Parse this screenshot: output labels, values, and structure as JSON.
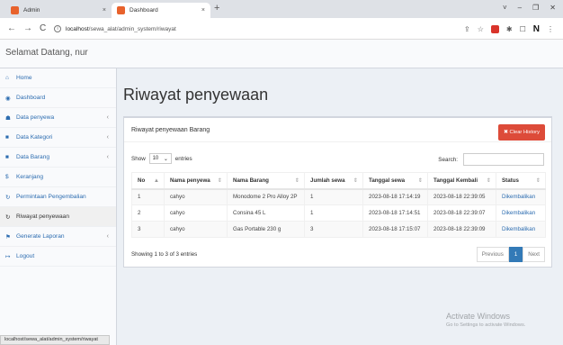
{
  "browser": {
    "tabs": [
      {
        "title": "Admin",
        "close": "×"
      },
      {
        "title": "Dashboard",
        "close": "×"
      }
    ],
    "new_tab": "+",
    "window_controls": [
      "˅",
      "–",
      "❐",
      "✕"
    ],
    "url_host": "localhost",
    "url_path": "/sewa_alat/admin_system/riwayat",
    "status_url": "localhost/sewa_alat/admin_system/riwayat"
  },
  "header": {
    "welcome": "Selamat Datang, nur"
  },
  "sidebar": {
    "items": [
      {
        "icon": "⌂",
        "label": "Home",
        "chevron": ""
      },
      {
        "icon": "◉",
        "label": "Dashboard",
        "chevron": ""
      },
      {
        "icon": "☗",
        "label": "Data penyewa",
        "chevron": "‹"
      },
      {
        "icon": "■",
        "label": "Data Kategori",
        "chevron": "‹"
      },
      {
        "icon": "■",
        "label": "Data Barang",
        "chevron": "‹"
      },
      {
        "icon": "$",
        "label": "Keranjang",
        "chevron": ""
      },
      {
        "icon": "↻",
        "label": "Permintaan Pengembalian",
        "chevron": ""
      },
      {
        "icon": "↻",
        "label": "Riwayat penyewaan",
        "chevron": ""
      },
      {
        "icon": "⚑",
        "label": "Generate Laporan",
        "chevron": "‹"
      },
      {
        "icon": "↦",
        "label": "Logout",
        "chevron": ""
      }
    ]
  },
  "main": {
    "title": "Riwayat penyewaan",
    "box_title": "Riwayat penyewaan Barang",
    "clear_button": "✖ Clear History",
    "show_label": "Show",
    "entries_value": "10",
    "entries_label": "entries",
    "search_label": "Search:",
    "columns": [
      "No",
      "Nama penyewa",
      "Nama Barang",
      "Jumlah sewa",
      "Tanggal sewa",
      "Tanggal Kembali",
      "Status"
    ],
    "rows": [
      [
        "1",
        "cahyo",
        "Monodome 2 Pro Alloy 2P",
        "1",
        "2023-08-18 17:14:19",
        "2023-08-18 22:39:05",
        "Dikembalikan"
      ],
      [
        "2",
        "cahyo",
        "Consina 45 L",
        "1",
        "2023-08-18 17:14:51",
        "2023-08-18 22:39:07",
        "Dikembalikan"
      ],
      [
        "3",
        "cahyo",
        "Gas Portable 230 g",
        "3",
        "2023-08-18 17:15:07",
        "2023-08-18 22:39:09",
        "Dikembalikan"
      ]
    ],
    "info": "Showing 1 to 3 of 3 entries",
    "pager": {
      "prev": "Previous",
      "current": "1",
      "next": "Next"
    }
  },
  "watermark": {
    "line1": "Activate Windows",
    "line2": "Go to Settings to activate Windows."
  }
}
